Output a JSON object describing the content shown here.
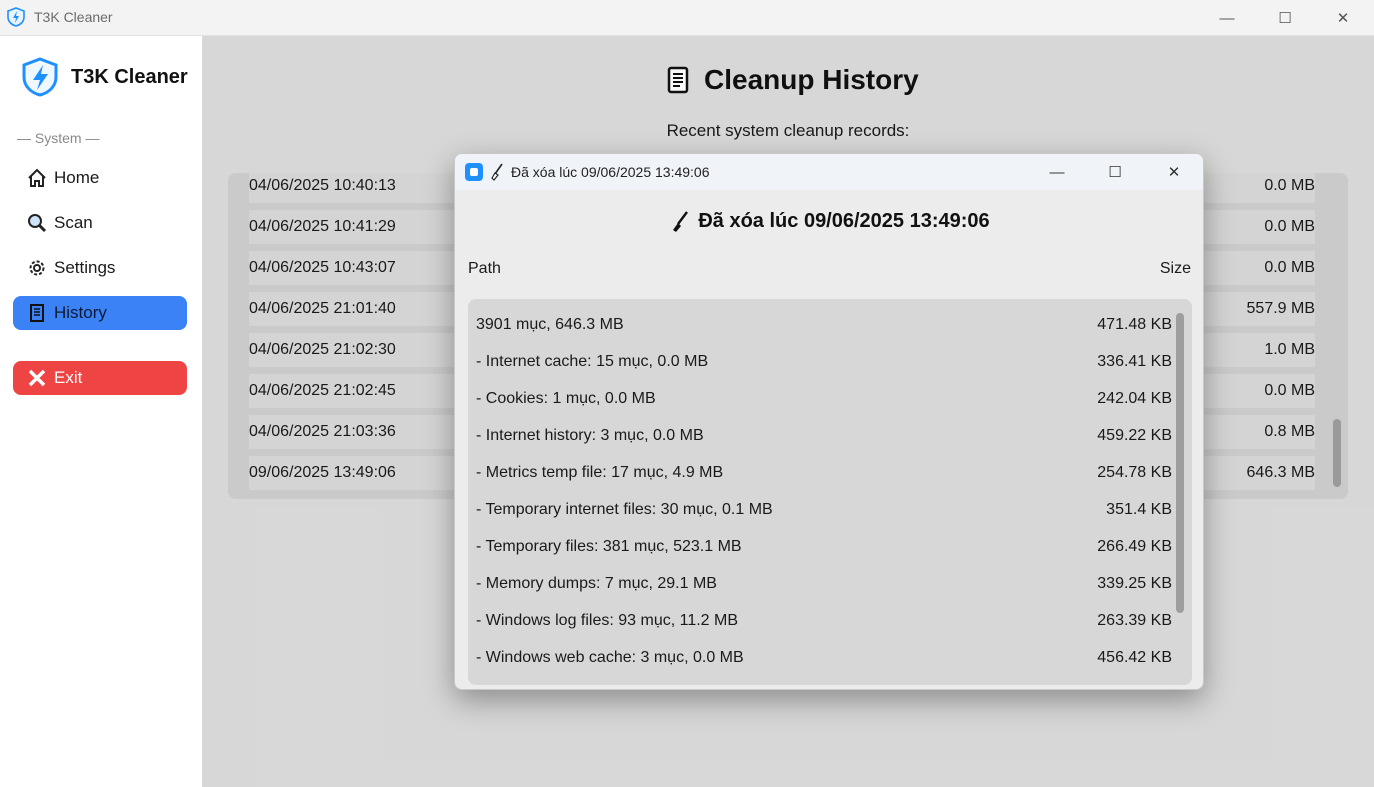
{
  "window": {
    "title": "T3K Cleaner",
    "minimize": "—",
    "maximize": "☐",
    "close": "✕"
  },
  "sidebar": {
    "brand": "T3K Cleaner",
    "section": "— System —",
    "items": [
      {
        "label": "Home",
        "icon": "home-icon"
      },
      {
        "label": "Scan",
        "icon": "magnifier-icon"
      },
      {
        "label": "Settings",
        "icon": "gear-icon"
      },
      {
        "label": "History",
        "icon": "scroll-icon",
        "active": true
      }
    ],
    "exit": {
      "label": "Exit",
      "icon": "cross-icon"
    }
  },
  "main": {
    "title": "Cleanup History",
    "subtitle": "Recent system cleanup records:",
    "records": [
      {
        "date": "04/06/2025 10:40:13",
        "size": "0.0 MB"
      },
      {
        "date": "04/06/2025 10:41:29",
        "size": "0.0 MB"
      },
      {
        "date": "04/06/2025 10:43:07",
        "size": "0.0 MB"
      },
      {
        "date": "04/06/2025 21:01:40",
        "size": "557.9 MB"
      },
      {
        "date": "04/06/2025 21:02:30",
        "size": "1.0 MB"
      },
      {
        "date": "04/06/2025 21:02:45",
        "size": "0.0 MB"
      },
      {
        "date": "04/06/2025 21:03:36",
        "size": "0.8 MB"
      },
      {
        "date": "09/06/2025 13:49:06",
        "size": "646.3 MB"
      }
    ]
  },
  "dialog": {
    "title": "Đã xóa lúc 09/06/2025 13:49:06",
    "heading": "Đã xóa lúc 09/06/2025 13:49:06",
    "col_path": "Path",
    "col_size": "Size",
    "minimize": "—",
    "maximize": "☐",
    "close": "✕",
    "rows": [
      {
        "path": "3901 mục, 646.3 MB",
        "size": "471.48 KB"
      },
      {
        "path": "- Internet cache: 15 mục, 0.0 MB",
        "size": "336.41 KB"
      },
      {
        "path": "- Cookies: 1 mục, 0.0 MB",
        "size": "242.04 KB"
      },
      {
        "path": "- Internet history: 3 mục, 0.0 MB",
        "size": "459.22 KB"
      },
      {
        "path": "- Metrics temp file: 17 mục, 4.9 MB",
        "size": "254.78 KB"
      },
      {
        "path": "- Temporary internet files: 30 mục, 0.1 MB",
        "size": "351.4 KB"
      },
      {
        "path": "- Temporary files: 381 mục, 523.1 MB",
        "size": "266.49 KB"
      },
      {
        "path": "- Memory dumps: 7 mục, 29.1 MB",
        "size": "339.25 KB"
      },
      {
        "path": "- Windows log files: 93 mục, 11.2 MB",
        "size": "263.39 KB"
      },
      {
        "path": "- Windows web cache: 3 mục, 0.0 MB",
        "size": "456.42 KB"
      }
    ]
  },
  "colors": {
    "accent": "#3b82f6",
    "danger": "#ef4444",
    "brand_blue": "#1e90ff"
  }
}
